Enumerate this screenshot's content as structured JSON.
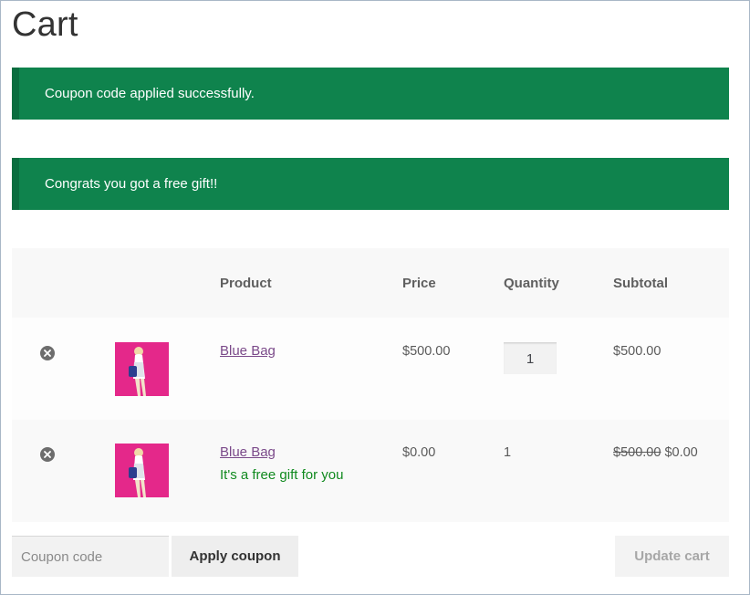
{
  "page": {
    "title": "Cart"
  },
  "notices": [
    {
      "text": "Coupon code applied successfully."
    },
    {
      "text": "Congrats you got a free gift!!"
    }
  ],
  "table": {
    "headers": {
      "product": "Product",
      "price": "Price",
      "quantity": "Quantity",
      "subtotal": "Subtotal"
    },
    "rows": [
      {
        "product": "Blue Bag",
        "price": "$500.00",
        "quantity": "1",
        "subtotal": "$500.00"
      },
      {
        "product": "Blue Bag",
        "note": "It's a free gift for you",
        "price": "$0.00",
        "quantity": "1",
        "subtotal_original": "$500.00",
        "subtotal": "$0.00"
      }
    ]
  },
  "actions": {
    "coupon_placeholder": "Coupon code",
    "apply_label": "Apply coupon",
    "update_label": "Update cart"
  },
  "colors": {
    "notice_bg": "#0f834d",
    "link": "#7b4a8a",
    "gift_note": "#118a1f",
    "thumb_bg": "#e4288a"
  }
}
